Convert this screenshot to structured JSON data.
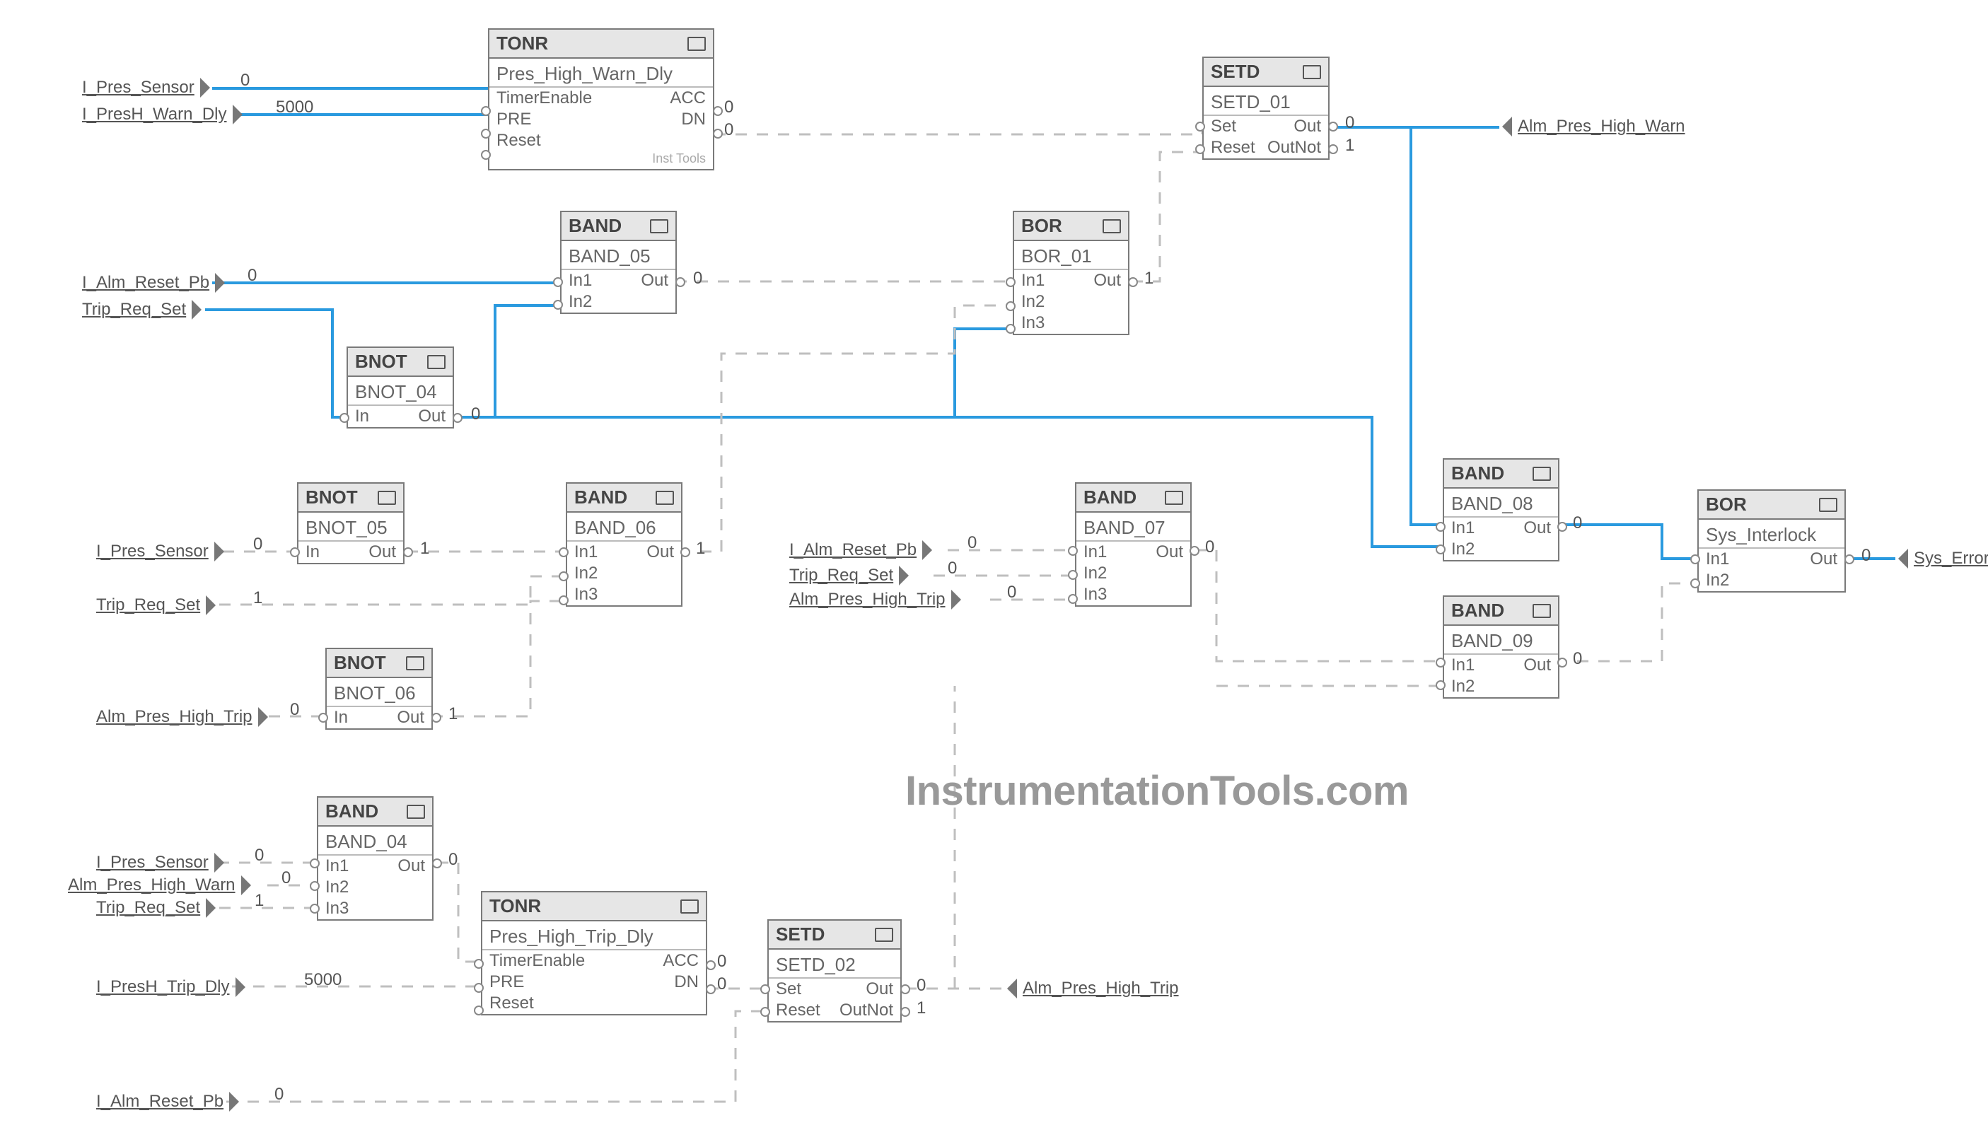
{
  "watermark": "InstrumentationTools.com",
  "tags": {
    "I_Pres_Sensor_1": "I_Pres_Sensor",
    "I_PresH_Warn_Dly": "I_PresH_Warn_Dly",
    "I_Alm_Reset_Pb_1": "I_Alm_Reset_Pb",
    "Trip_Req_Set_1": "Trip_Req_Set",
    "I_Pres_Sensor_2": "I_Pres_Sensor",
    "Trip_Req_Set_2": "Trip_Req_Set",
    "Alm_Pres_High_Trip_in": "Alm_Pres_High_Trip",
    "I_Alm_Reset_Pb_2": "I_Alm_Reset_Pb",
    "Trip_Req_Set_3": "Trip_Req_Set",
    "Alm_Pres_High_Trip_2": "Alm_Pres_High_Trip",
    "I_Pres_Sensor_3": "I_Pres_Sensor",
    "Alm_Pres_High_Warn_in": "Alm_Pres_High_Warn",
    "Trip_Req_Set_4": "Trip_Req_Set",
    "I_PresH_Trip_Dly": "I_PresH_Trip_Dly",
    "I_Alm_Reset_Pb_3": "I_Alm_Reset_Pb",
    "Alm_Pres_High_Warn_out": "Alm_Pres_High_Warn",
    "Alm_Pres_High_Trip_out": "Alm_Pres_High_Trip",
    "Sys_Error": "Sys_Error"
  },
  "values": {
    "I_Pres_Sensor_1": "0",
    "I_PresH_Warn_Dly": "5000",
    "TONR1_ACC": "0",
    "TONR1_DN": "0",
    "I_Alm_Reset_Pb_1": "0",
    "BAND_05_Out": "0",
    "BNOT_04_Out": "0",
    "BOR_01_Out": "1",
    "SETD_01_Out": "0",
    "SETD_01_OutNot": "1",
    "I_Pres_Sensor_2": "0",
    "BNOT_05_Out": "1",
    "Trip_Req_Set_2": "1",
    "BAND_06_Out": "1",
    "Alm_Pres_High_Trip_in": "0",
    "BNOT_06_Out": "1",
    "I_Alm_Reset_Pb_2": "0",
    "Trip_Req_Set_3": "0",
    "Alm_Pres_High_Trip_2": "0",
    "BAND_07_Out": "0",
    "BAND_08_Out": "0",
    "BAND_09_Out": "0",
    "Sys_Interlock_Out": "0",
    "I_Pres_Sensor_3": "0",
    "Alm_Pres_High_Warn_in": "0",
    "Trip_Req_Set_4": "1",
    "BAND_04_Out": "0",
    "I_PresH_Trip_Dly": "5000",
    "TONR2_ACC": "0",
    "TONR2_DN": "0",
    "SETD_02_Out": "0",
    "SETD_02_OutNot": "1",
    "I_Alm_Reset_Pb_3": "0"
  },
  "blocks": {
    "TONR1": {
      "title": "TONR",
      "name": "Pres_High_Warn_Dly",
      "ports_left": [
        "TimerEnable",
        "PRE",
        "Reset"
      ],
      "ports_right": [
        "ACC",
        "DN",
        ""
      ],
      "footnote": "Inst Tools"
    },
    "BAND_05": {
      "title": "BAND",
      "name": "BAND_05",
      "ports_left": [
        "In1",
        "In2"
      ],
      "ports_right": [
        "Out",
        ""
      ]
    },
    "BNOT_04": {
      "title": "BNOT",
      "name": "BNOT_04",
      "ports_left": [
        "In"
      ],
      "ports_right": [
        "Out"
      ]
    },
    "BOR_01": {
      "title": "BOR",
      "name": "BOR_01",
      "ports_left": [
        "In1",
        "In2",
        "In3"
      ],
      "ports_right": [
        "Out",
        "",
        ""
      ]
    },
    "SETD_01": {
      "title": "SETD",
      "name": "SETD_01",
      "ports_left": [
        "Set",
        "Reset"
      ],
      "ports_right": [
        "Out",
        "OutNot"
      ]
    },
    "BNOT_05": {
      "title": "BNOT",
      "name": "BNOT_05",
      "ports_left": [
        "In"
      ],
      "ports_right": [
        "Out"
      ]
    },
    "BAND_06": {
      "title": "BAND",
      "name": "BAND_06",
      "ports_left": [
        "In1",
        "In2",
        "In3"
      ],
      "ports_right": [
        "Out",
        "",
        ""
      ]
    },
    "BNOT_06": {
      "title": "BNOT",
      "name": "BNOT_06",
      "ports_left": [
        "In"
      ],
      "ports_right": [
        "Out"
      ]
    },
    "BAND_07": {
      "title": "BAND",
      "name": "BAND_07",
      "ports_left": [
        "In1",
        "In2",
        "In3"
      ],
      "ports_right": [
        "Out",
        "",
        ""
      ]
    },
    "BAND_08": {
      "title": "BAND",
      "name": "BAND_08",
      "ports_left": [
        "In1",
        "In2"
      ],
      "ports_right": [
        "Out",
        ""
      ]
    },
    "BAND_09": {
      "title": "BAND",
      "name": "BAND_09",
      "ports_left": [
        "In1",
        "In2"
      ],
      "ports_right": [
        "Out",
        ""
      ]
    },
    "Sys_Interlock": {
      "title": "BOR",
      "name": "Sys_Interlock",
      "ports_left": [
        "In1",
        "In2"
      ],
      "ports_right": [
        "Out",
        ""
      ]
    },
    "BAND_04": {
      "title": "BAND",
      "name": "BAND_04",
      "ports_left": [
        "In1",
        "In2",
        "In3"
      ],
      "ports_right": [
        "Out",
        "",
        ""
      ]
    },
    "TONR2": {
      "title": "TONR",
      "name": "Pres_High_Trip_Dly",
      "ports_left": [
        "TimerEnable",
        "PRE",
        "Reset"
      ],
      "ports_right": [
        "ACC",
        "DN",
        ""
      ]
    },
    "SETD_02": {
      "title": "SETD",
      "name": "SETD_02",
      "ports_left": [
        "Set",
        "Reset"
      ],
      "ports_right": [
        "Out",
        "OutNot"
      ]
    }
  }
}
